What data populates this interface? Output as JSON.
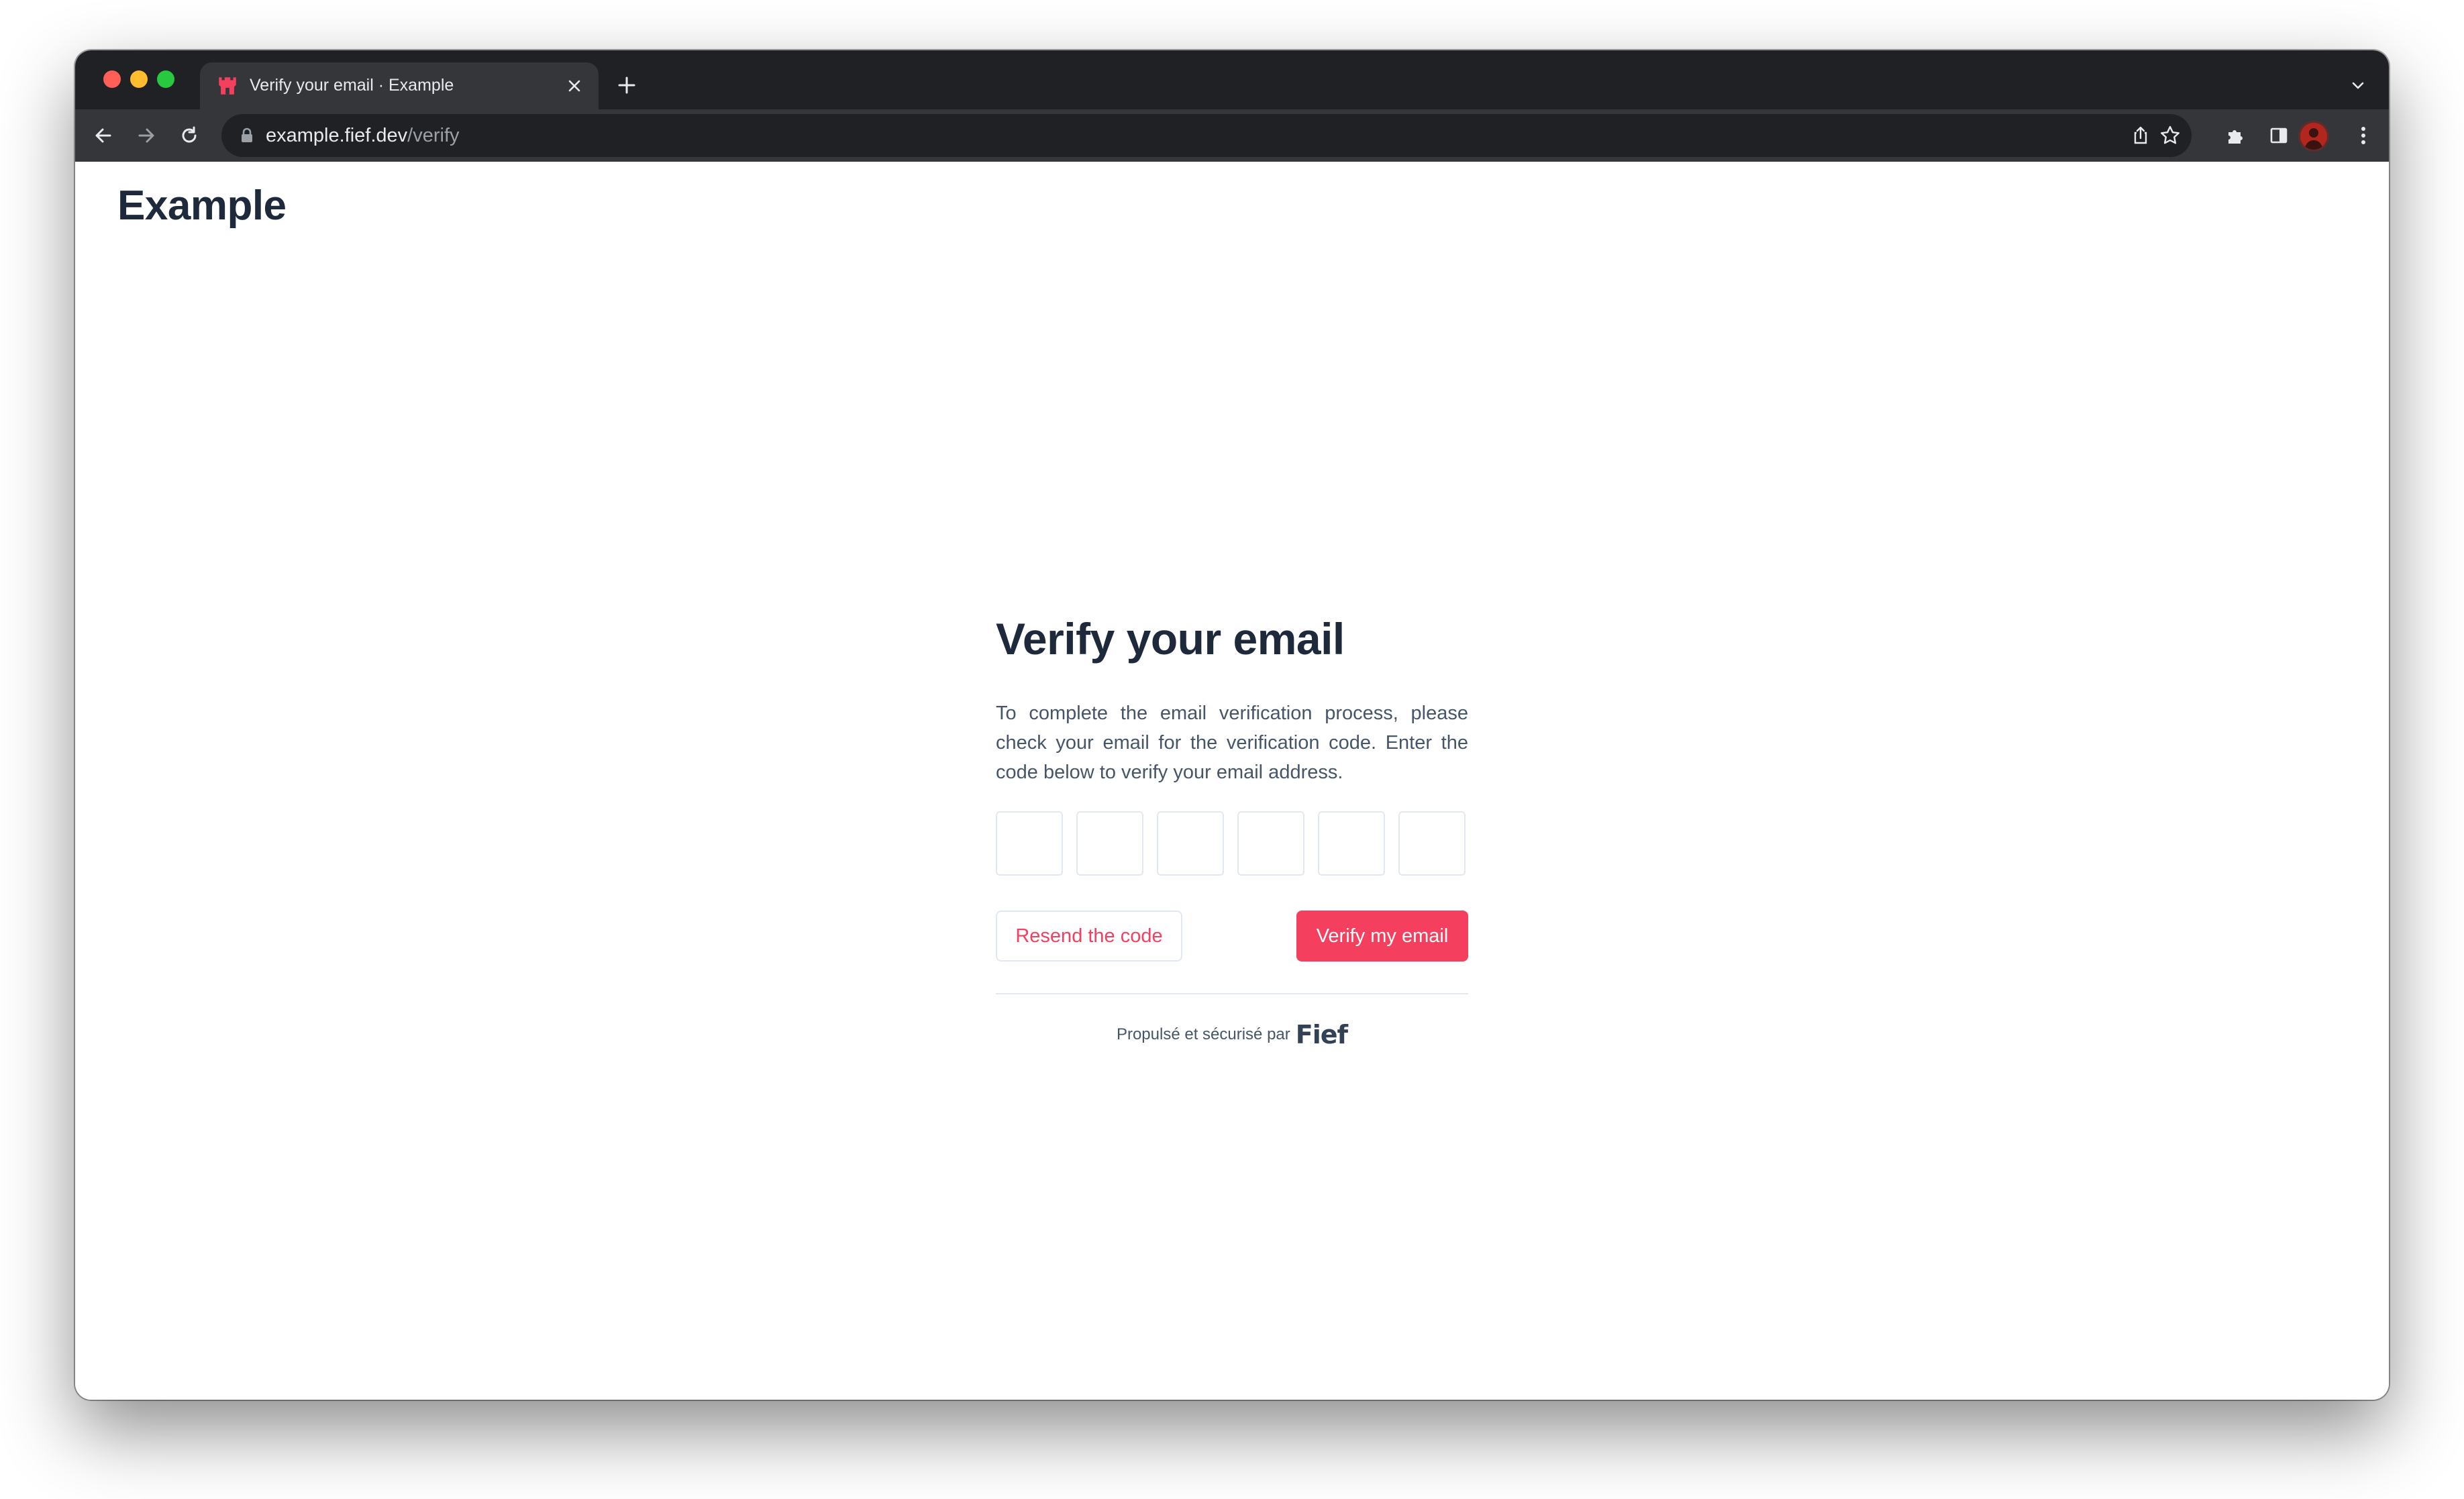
{
  "browser": {
    "tab": {
      "title": "Verify your email · Example",
      "favicon": "fief-castle-icon"
    },
    "address": {
      "host": "example.fief.dev",
      "path": "/verify"
    },
    "colors": {
      "tabstrip": "#202124",
      "toolbar": "#35363a",
      "traffic_red": "#ff5f57",
      "traffic_yellow": "#febc2e",
      "traffic_green": "#28c840"
    }
  },
  "page": {
    "brand": "Example",
    "title": "Verify your email",
    "description": "To complete the email verification process, please check your email for the verification code. Enter the code below to verify your email address.",
    "code": [
      "",
      "",
      "",
      "",
      "",
      ""
    ],
    "resend_label": "Resend the code",
    "verify_label": "Verify my email",
    "footer_text": "Propulsé et sécurisé par",
    "footer_logo": "Fief",
    "colors": {
      "accent": "#f43f5e",
      "heading": "#1e293b",
      "body_text": "#475569",
      "border": "#e2e8f0"
    }
  }
}
